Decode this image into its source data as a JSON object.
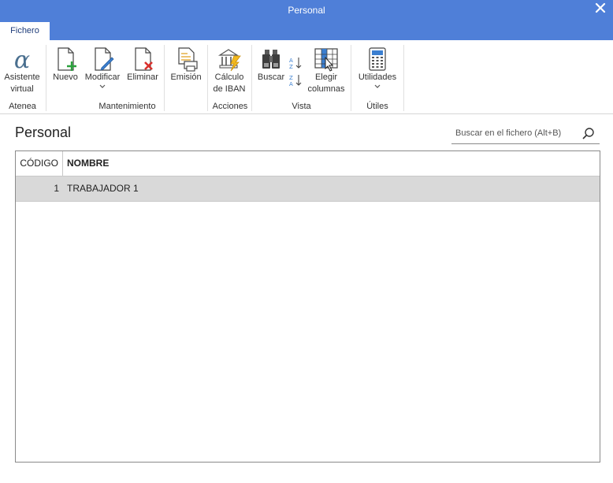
{
  "window": {
    "title": "Personal"
  },
  "tabs": [
    {
      "label": "Fichero"
    }
  ],
  "ribbon": {
    "atenea": {
      "group_label": "Atenea",
      "asistente_line1": "Asistente",
      "asistente_line2": "virtual"
    },
    "mantenimiento": {
      "group_label": "Mantenimiento",
      "nuevo": "Nuevo",
      "modificar": "Modificar",
      "eliminar": "Eliminar",
      "emision": "Emisión"
    },
    "acciones": {
      "group_label": "Acciones",
      "calculo_line1": "Cálculo",
      "calculo_line2": "de IBAN"
    },
    "vista": {
      "group_label": "Vista",
      "buscar": "Buscar",
      "elegir_line1": "Elegir",
      "elegir_line2": "columnas"
    },
    "utiles": {
      "group_label": "Útiles",
      "utilidades": "Utilidades"
    }
  },
  "main": {
    "title": "Personal",
    "search": {
      "placeholder": "Buscar en el fichero (Alt+B)"
    },
    "table": {
      "columns": [
        "CÓDIGO",
        "NOMBRE"
      ],
      "rows": [
        {
          "codigo": "1",
          "nombre": "TRABAJADOR 1"
        }
      ]
    }
  },
  "colors": {
    "titlebar": "#4f7fd8",
    "selected_row": "#d9d9d9"
  }
}
